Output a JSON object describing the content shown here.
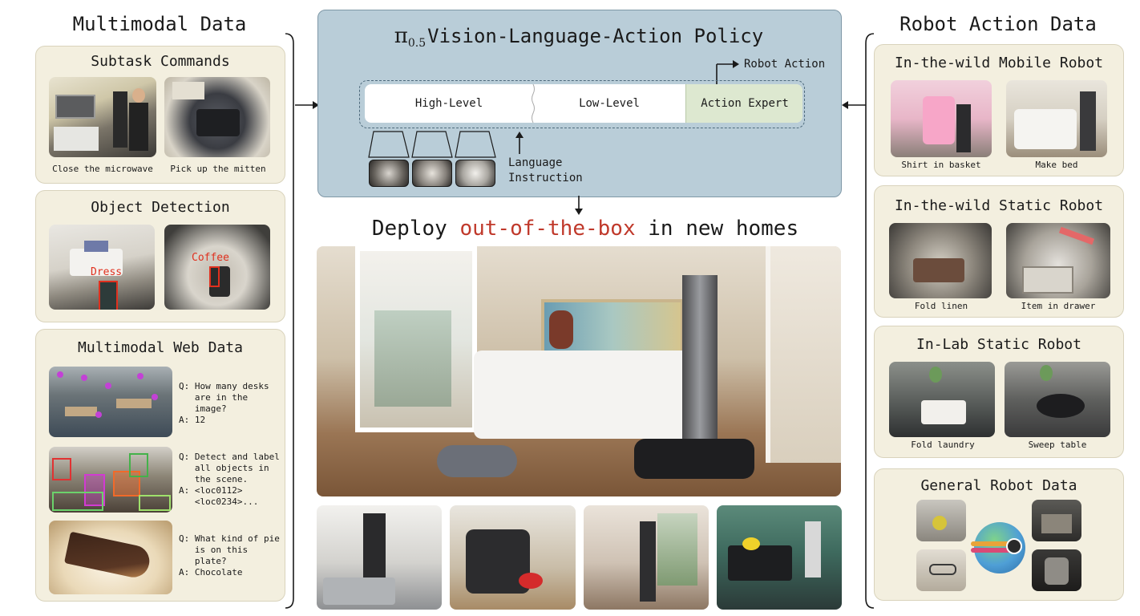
{
  "left": {
    "title": "Multimodal Data",
    "subtask": {
      "title": "Subtask Commands",
      "captions": [
        "Close the microwave",
        "Pick up the mitten"
      ]
    },
    "detection": {
      "title": "Object Detection",
      "labels": [
        "Dress",
        "Coffee"
      ]
    },
    "web": {
      "title": "Multimodal Web Data",
      "items": [
        {
          "q": "Q: How many desks\n   are in the\n   image?",
          "a": "A: 12"
        },
        {
          "q": "Q: Detect and label\n   all objects in\n   the scene.",
          "a": "A: <loc0112>\n   <loc0234>..."
        },
        {
          "q": "Q: What kind of pie\n   is on this\n   plate?",
          "a": "A: Chocolate"
        }
      ]
    }
  },
  "center": {
    "policy_title_symbol": "π",
    "policy_title_sub": "0.5",
    "policy_title_rest": "Vision-Language-Action Policy",
    "robot_action": "Robot Action",
    "high_level": "High-Level",
    "low_level": "Low-Level",
    "action_expert": "Action Expert",
    "language": "Language",
    "instruction": "Instruction",
    "deploy_pre": "Deploy ",
    "deploy_highlight": "out-of-the-box",
    "deploy_post": " in new homes",
    "colors": {
      "policy_bg": "#b9cdd8",
      "action_expert_bg": "#dde8d0",
      "highlight": "#c0392b"
    }
  },
  "right": {
    "title": "Robot Action Data",
    "mobile": {
      "title": "In-the-wild Mobile Robot",
      "captions": [
        "Shirt in basket",
        "Make bed"
      ]
    },
    "static": {
      "title": "In-the-wild Static Robot",
      "captions": [
        "Fold linen",
        "Item in drawer"
      ]
    },
    "lab": {
      "title": "In-Lab Static Robot",
      "captions": [
        "Fold laundry",
        "Sweep table"
      ]
    },
    "general": {
      "title": "General Robot Data"
    }
  }
}
